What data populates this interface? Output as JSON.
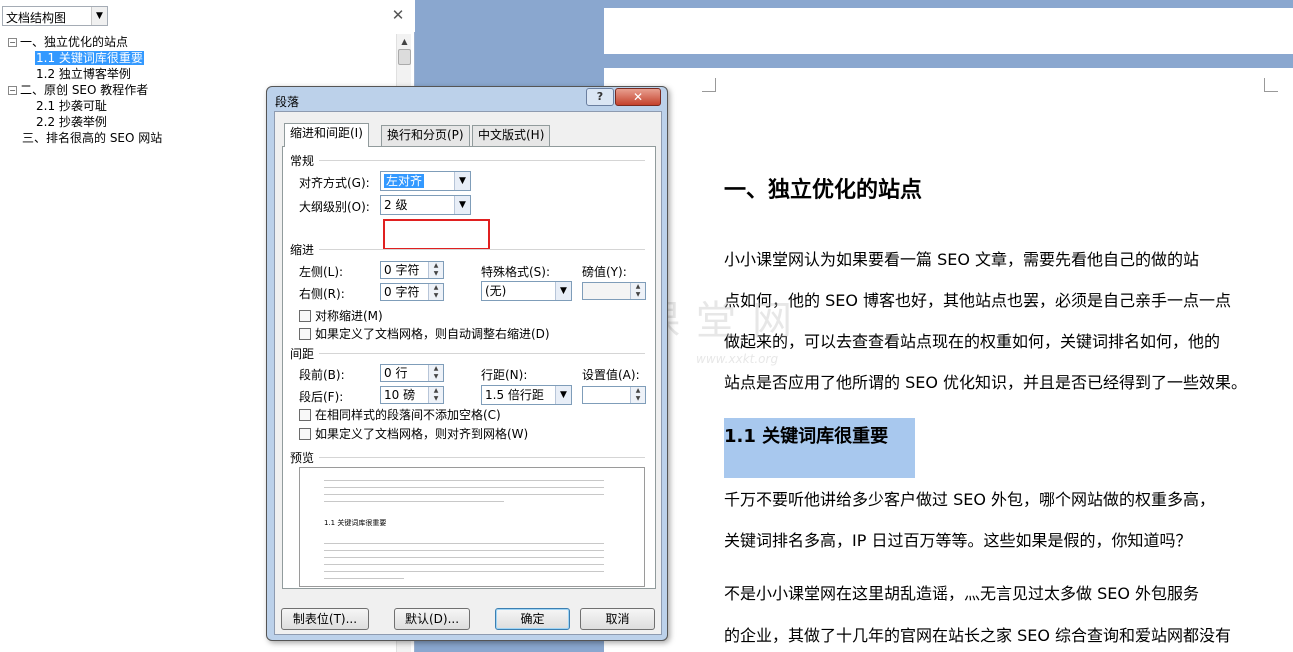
{
  "document_map": {
    "view_select": "文档结构图",
    "close_glyph": "✕",
    "items": [
      {
        "toggle": "⊟",
        "label": "一、独立优化的站点"
      },
      {
        "toggle": "",
        "label": "1.1 关键词库很重要"
      },
      {
        "toggle": "",
        "label": "1.2 独立博客举例"
      },
      {
        "toggle": "⊟",
        "label": "二、原创 SEO 教程作者"
      },
      {
        "toggle": "",
        "label": "2.1 抄袭可耻"
      },
      {
        "toggle": "",
        "label": "2.2 抄袭举例"
      },
      {
        "toggle": "",
        "label": "三、排名很高的 SEO 网站"
      }
    ]
  },
  "document": {
    "heading1": "一、独立优化的站点",
    "para1": [
      "小小课堂网认为如果要看一篇 SEO 文章，需要先看他自己的做的站",
      "点如何，他的 SEO 博客也好，其他站点也罢，必须是自己亲手一点一点",
      "做起来的，可以去查查看站点现在的权重如何，关键词排名如何，他的",
      "站点是否应用了他所谓的  SEO  优化知识，并且是否已经得到了一些效果。"
    ],
    "heading2": "1.1 关键词库很重要",
    "para2": [
      "千万不要听他讲给多少客户做过  SEO  外包，哪个网站做的权重多高，",
      "关键词排名多高，IP 日过百万等等。这些如果是假的，你知道吗？"
    ],
    "para3": [
      "不是小小课堂网在这里胡乱造谣，灬无言见过太多做 SEO 外包服务",
      "的企业，其做了十几年的官网在站长之家 SEO 综合查询和爱站网都没有"
    ]
  },
  "watermark": {
    "logo": "X",
    "title": "小小课堂网",
    "url": "www.xxkt.org"
  },
  "dialog": {
    "title": "段落",
    "help_label": "?",
    "close_label": "✕",
    "tabs": [
      "缩进和间距(I)",
      "换行和分页(P)",
      "中文版式(H)"
    ],
    "general": {
      "title": "常规",
      "alignment_label": "对齐方式(G):",
      "alignment_value": "左对齐",
      "outline_label": "大纲级别(O):",
      "outline_value": "2 级"
    },
    "indent": {
      "title": "缩进",
      "left_label": "左侧(L):",
      "left_value": "0 字符",
      "right_label": "右侧(R):",
      "right_value": "0 字符",
      "special_label": "特殊格式(S):",
      "special_value": "(无)",
      "by_label": "磅值(Y):",
      "by_value": "",
      "mirror_label": "对称缩进(M)",
      "grid_label": "如果定义了文档网格，则自动调整右缩进(D)"
    },
    "spacing": {
      "title": "间距",
      "before_label": "段前(B):",
      "before_value": "0 行",
      "after_label": "段后(F):",
      "after_value": "10 磅",
      "line_label": "行距(N):",
      "line_value": "1.5 倍行距",
      "at_label": "设置值(A):",
      "at_value": "",
      "no_space_label": "在相同样式的段落间不添加空格(C)",
      "snap_grid_label": "如果定义了文档网格，则对齐到网格(W)"
    },
    "preview": {
      "title": "预览",
      "heading_text": "1.1 关键词库很重要"
    },
    "buttons": {
      "tabs": "制表位(T)...",
      "default": "默认(D)...",
      "ok": "确定",
      "cancel": "取消"
    }
  }
}
